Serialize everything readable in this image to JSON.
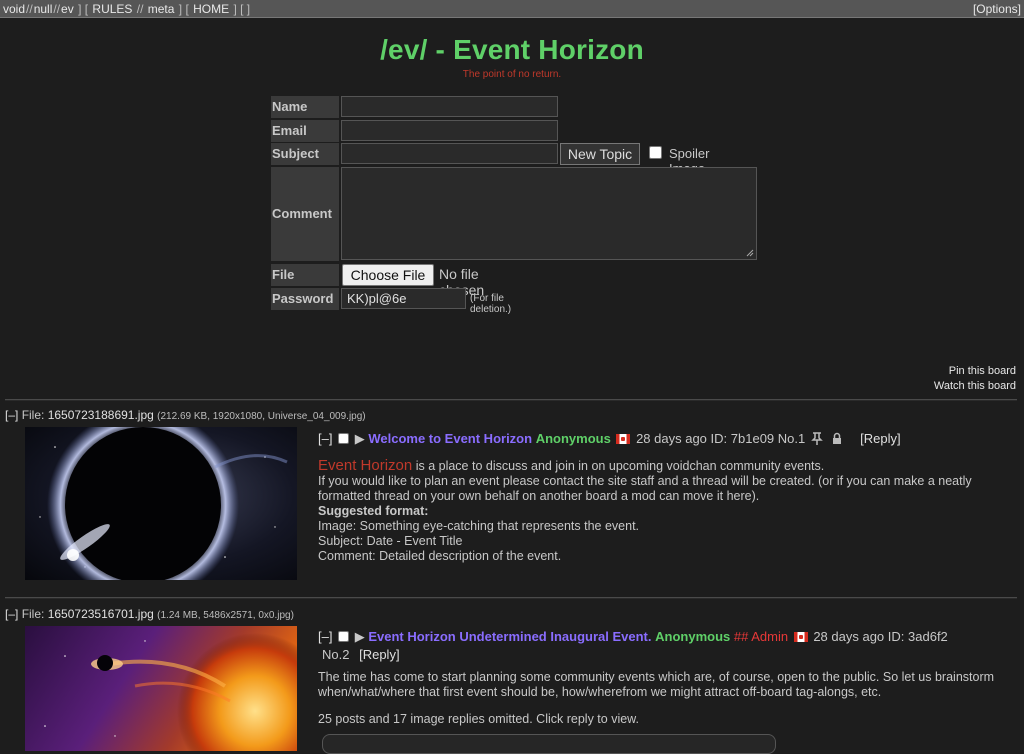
{
  "topnav": {
    "links": [
      "void",
      "null",
      "ev"
    ],
    "rules": "RULES",
    "meta": "meta",
    "home": "HOME",
    "empty": "",
    "options": "Options"
  },
  "header": {
    "title": "/ev/ - Event Horizon",
    "subtitle": "The point of no return."
  },
  "form": {
    "name_label": "Name",
    "email_label": "Email",
    "subject_label": "Subject",
    "comment_label": "Comment",
    "file_label": "File",
    "password_label": "Password",
    "new_topic": "New Topic",
    "spoiler_label": "Spoiler Image",
    "choose_file": "Choose File",
    "no_file": "No file chosen",
    "password_value": "KK)pl@6e",
    "password_hint": "(For file deletion.)"
  },
  "board_actions": {
    "pin": "Pin this board",
    "watch": "Watch this board"
  },
  "threads": [
    {
      "toggle": "[–]",
      "file_prefix": "File:",
      "file_name": "1650723188691.jpg",
      "file_meta": "(212.69 KB, 1920x1080, Universe_04_009.jpg)",
      "subject": "Welcome to Event Horizon",
      "name": "Anonymous",
      "time": "28 days ago",
      "id": "ID: 7b1e09",
      "no": "No.1",
      "reply": "[Reply]",
      "body_highlight": "Event Horizon",
      "body_line1": " is a place to discuss and join in on upcoming voidchan community events.",
      "body_line2": "If you would like to plan an event please contact the site staff and a thread will be created. (or if you can make a neatly formatted thread on your own behalf on another board a mod can move it here).",
      "body_heading": "Suggested format:",
      "body_line3": "Image: Something eye-catching that represents the event.",
      "body_line4": "Subject: Date - Event Title",
      "body_line5": "Comment: Detailed description of the event."
    },
    {
      "toggle": "[–]",
      "file_prefix": "File:",
      "file_name": "1650723516701.jpg",
      "file_meta": "(1.24 MB, 5486x2571, 0x0.jpg)",
      "subject": "Event Horizon Undetermined Inaugural Event.",
      "name": "Anonymous",
      "capcode": "## Admin",
      "time": "28 days ago",
      "id": "ID: 3ad6f2",
      "no": "No.2",
      "reply": "[Reply]",
      "body_line1": "The time has come to start planning some community events which are, of course, open to the public. So let us brainstorm when/what/where that first event should be, how/wherefrom we might attract off-board tag-alongs, etc.",
      "omitted": "25 posts and 17 image replies omitted. Click reply to view."
    }
  ]
}
